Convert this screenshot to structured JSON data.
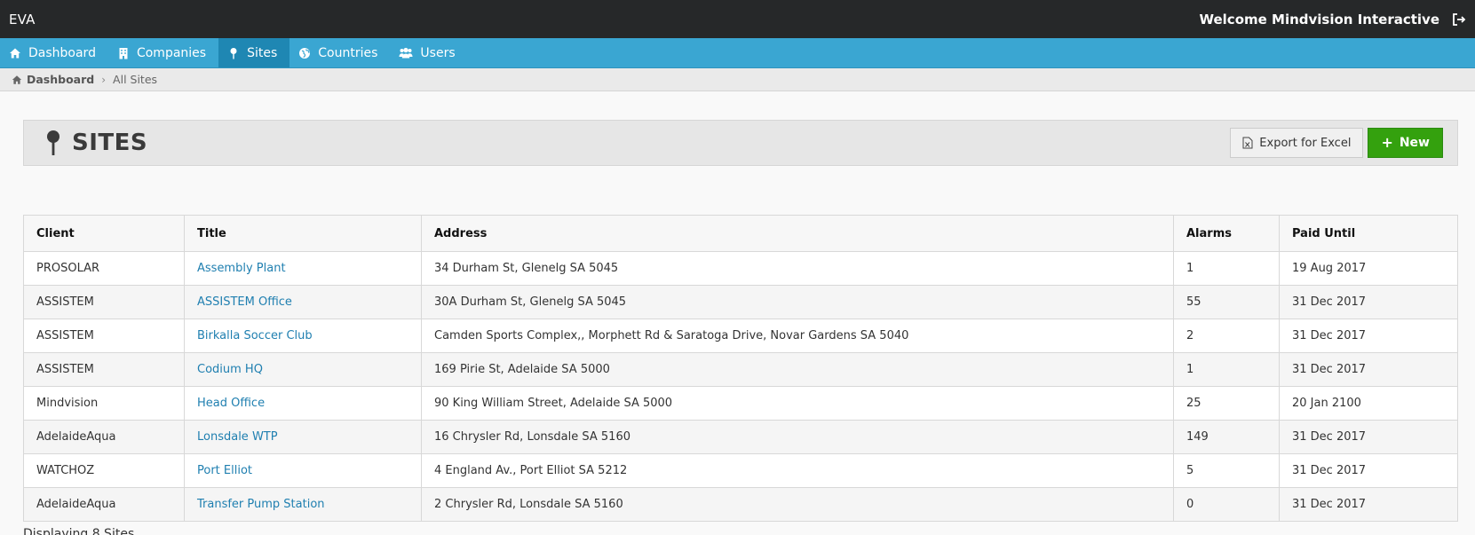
{
  "topbar": {
    "brand": "EVA",
    "welcome": "Welcome Mindvision Interactive"
  },
  "nav": {
    "items": [
      {
        "label": "Dashboard",
        "icon": "home-icon"
      },
      {
        "label": "Companies",
        "icon": "building-icon"
      },
      {
        "label": "Sites",
        "icon": "pin-icon",
        "active": true
      },
      {
        "label": "Countries",
        "icon": "globe-icon"
      },
      {
        "label": "Users",
        "icon": "users-icon"
      }
    ]
  },
  "breadcrumb": {
    "home": "Dashboard",
    "current": "All Sites"
  },
  "header": {
    "title": "SITES",
    "export_label": "Export for Excel",
    "new_label": "New"
  },
  "table": {
    "columns": [
      "Client",
      "Title",
      "Address",
      "Alarms",
      "Paid Until"
    ],
    "rows": [
      {
        "client": "PROSOLAR",
        "title": "Assembly Plant",
        "address": "34 Durham St, Glenelg SA 5045",
        "alarms": "1",
        "paid": "19 Aug 2017"
      },
      {
        "client": "ASSISTEM",
        "title": "ASSISTEM Office",
        "address": "30A Durham St, Glenelg SA 5045",
        "alarms": "55",
        "paid": "31 Dec 2017"
      },
      {
        "client": "ASSISTEM",
        "title": "Birkalla Soccer Club",
        "address": "Camden Sports Complex,, Morphett Rd & Saratoga Drive, Novar Gardens SA 5040",
        "alarms": "2",
        "paid": "31 Dec 2017"
      },
      {
        "client": "ASSISTEM",
        "title": "Codium HQ",
        "address": "169 Pirie St, Adelaide SA 5000",
        "alarms": "1",
        "paid": "31 Dec 2017"
      },
      {
        "client": "Mindvision",
        "title": "Head Office",
        "address": "90 King William Street, Adelaide SA 5000",
        "alarms": "25",
        "paid": "20 Jan 2100"
      },
      {
        "client": "AdelaideAqua",
        "title": "Lonsdale WTP",
        "address": "16 Chrysler Rd, Lonsdale SA 5160",
        "alarms": "149",
        "paid": "31 Dec 2017"
      },
      {
        "client": "WATCHOZ",
        "title": "Port Elliot",
        "address": "4 England Av., Port Elliot SA 5212",
        "alarms": "5",
        "paid": "31 Dec 2017"
      },
      {
        "client": "AdelaideAqua",
        "title": "Transfer Pump Station",
        "address": "2 Chrysler Rd, Lonsdale SA 5160",
        "alarms": "0",
        "paid": "31 Dec 2017"
      }
    ]
  },
  "footer": {
    "text": "Displaying 8 Sites"
  },
  "colors": {
    "topbar": "#262829",
    "navbar": "#3aa6d2",
    "nav_active": "#1f87b3",
    "link": "#1f7fb0",
    "new_button": "#34a10e"
  }
}
